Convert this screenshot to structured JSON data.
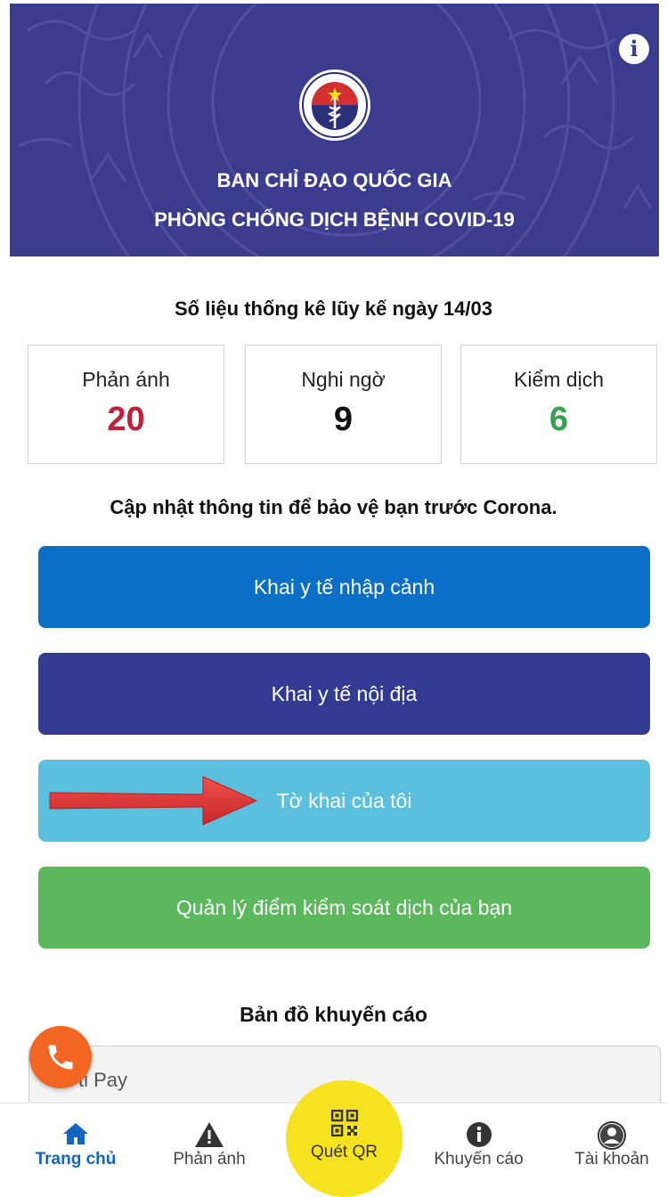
{
  "header": {
    "title_line1": "BAN CHỈ ĐẠO QUỐC GIA",
    "title_line2": "PHÒNG CHỐNG DỊCH BỆNH COVID-19",
    "logo_text": "BỘ Y TẾ",
    "info_icon": "info-icon"
  },
  "stats": {
    "title": "Số liệu thống kê lũy kế ngày 14/03",
    "items": [
      {
        "label": "Phản ánh",
        "value": "20",
        "color": "#c0203b"
      },
      {
        "label": "Nghi ngờ",
        "value": "9",
        "color": "#111111"
      },
      {
        "label": "Kiểm dịch",
        "value": "6",
        "color": "#33a44c"
      }
    ]
  },
  "subtitle": "Cập nhật thông tin để bảo vệ bạn trước Corona.",
  "buttons": [
    {
      "label": "Khai y tế nhập cảnh",
      "color": "#0b6fc8"
    },
    {
      "label": "Khai y tế nội địa",
      "color": "#323b91"
    },
    {
      "label": "Tờ khai của tôi",
      "color": "#5bc0de"
    },
    {
      "label": "Quản lý điểm kiểm soát dịch của bạn",
      "color": "#5cb85c"
    }
  ],
  "map": {
    "title": "Bản đồ khuyến cáo",
    "partial_text": "ṫi Pay"
  },
  "nav": {
    "items": [
      {
        "label": "Trang chủ",
        "icon": "home-icon"
      },
      {
        "label": "Phản ánh",
        "icon": "warning-icon"
      },
      {
        "label": "Quét QR",
        "icon": "qr-code-icon"
      },
      {
        "label": "Khuyến cáo",
        "icon": "info-icon"
      },
      {
        "label": "Tài khoản",
        "icon": "user-icon"
      }
    ]
  }
}
